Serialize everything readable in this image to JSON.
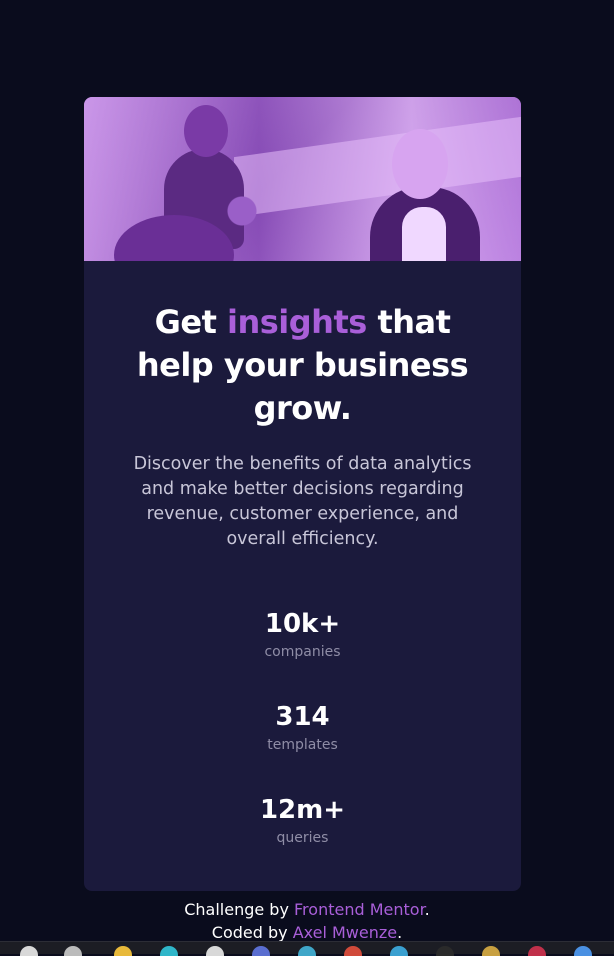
{
  "card": {
    "headline": {
      "before": "Get ",
      "accent": "insights",
      "after": " that help your business grow."
    },
    "description": "Discover the benefits of data analytics and make better decisions regarding revenue, customer experience, and overall efficiency.",
    "stats": [
      {
        "value": "10k+",
        "label": "companies"
      },
      {
        "value": "314",
        "label": "templates"
      },
      {
        "value": "12m+",
        "label": "queries"
      }
    ]
  },
  "attribution": {
    "line1_prefix": "Challenge by ",
    "line1_link": "Frontend Mentor",
    "line1_suffix": ".",
    "line2_prefix": "Coded by ",
    "line2_link": "Axel Mwenze",
    "line2_suffix": "."
  },
  "colors": {
    "page_bg": "#0a0c1d",
    "card_bg": "#1b1a3c",
    "accent": "#a95fd9",
    "text": "#ffffff",
    "muted": "#8f8da6"
  },
  "taskbar": {
    "icons": [
      "search-icon",
      "task-view-icon",
      "folder-icon",
      "browser-icon",
      "store-icon",
      "app-icon",
      "app-icon",
      "app-icon",
      "app-icon",
      "app-icon",
      "app-icon",
      "app-icon"
    ]
  }
}
